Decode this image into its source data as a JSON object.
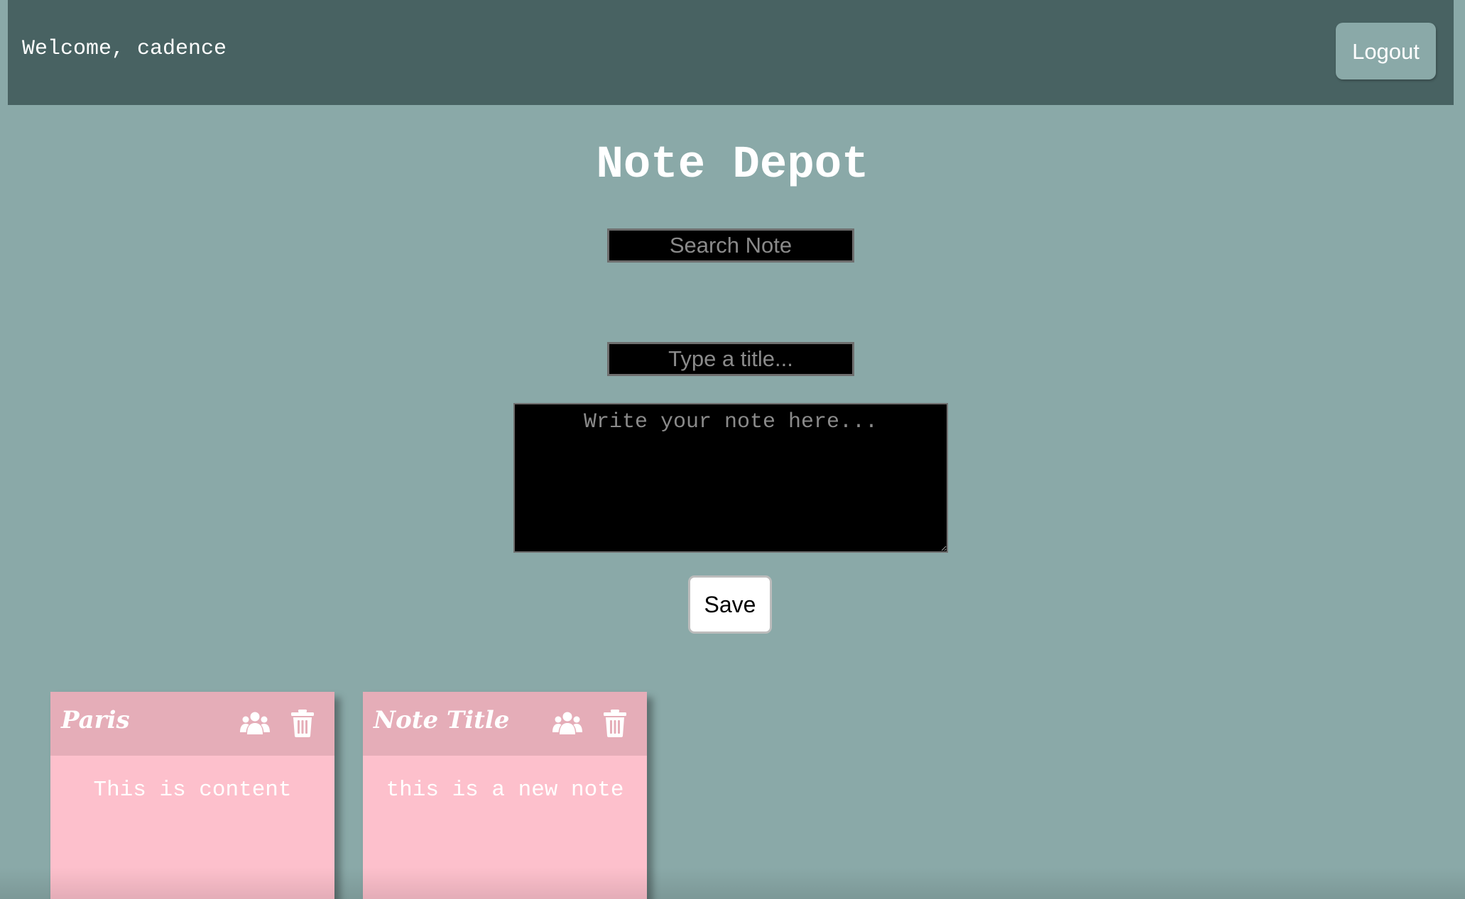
{
  "header": {
    "welcome_text": "Welcome, cadence",
    "logout_label": "Logout"
  },
  "main": {
    "title": "Note Depot",
    "search": {
      "placeholder": "Search Note",
      "value": ""
    },
    "new_note": {
      "title_placeholder": "Type a title...",
      "content_placeholder": "Write your note here...",
      "save_label": "Save"
    }
  },
  "notes": [
    {
      "title": "Paris",
      "content": "This is content",
      "share_icon": "users-icon",
      "delete_icon": "trash-icon"
    },
    {
      "title": "Note Title",
      "content": "this is a new note",
      "share_icon": "users-icon",
      "delete_icon": "trash-icon"
    }
  ],
  "colors": {
    "page_background": "#8aa9a8",
    "header_background": "#486262",
    "card_header": "#e5adb8",
    "card_body": "#fdc0cc"
  }
}
